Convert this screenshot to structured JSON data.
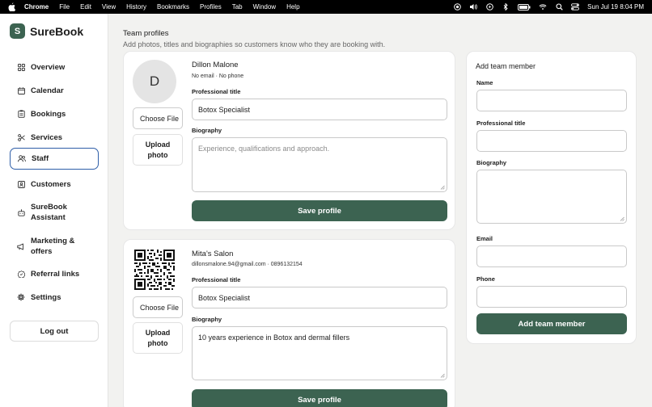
{
  "menubar": {
    "app": "Chrome",
    "items": [
      "File",
      "Edit",
      "View",
      "History",
      "Bookmarks",
      "Profiles",
      "Tab",
      "Window",
      "Help"
    ],
    "clock": "Sun Jul 19  8:04 PM"
  },
  "sidebar": {
    "brand_letter": "S",
    "brand_name": "SureBook",
    "items": [
      {
        "label": "Overview",
        "icon": "grid-icon"
      },
      {
        "label": "Calendar",
        "icon": "calendar-icon"
      },
      {
        "label": "Bookings",
        "icon": "clipboard-icon"
      },
      {
        "label": "Services",
        "icon": "scissors-icon"
      },
      {
        "label": "Staff",
        "icon": "users-icon",
        "active": true
      },
      {
        "label": "Customers",
        "icon": "id-card-icon"
      },
      {
        "label": "SureBook Assistant",
        "icon": "robot-icon"
      },
      {
        "label": "Marketing & offers",
        "icon": "megaphone-icon"
      },
      {
        "label": "Referral links",
        "icon": "badge-icon"
      },
      {
        "label": "Settings",
        "icon": "gear-icon"
      }
    ],
    "logout": "Log out"
  },
  "header": {
    "title": "Team profiles",
    "subtitle": "Add photos, titles and biographies so customers know who they are booking with."
  },
  "members": [
    {
      "avatar_letter": "D",
      "name": "Dillon Malone",
      "contact": "No email · No phone",
      "choose_file": "Choose File",
      "upload": "Upload photo",
      "title_label": "Professional title",
      "title_value": "Botox Specialist",
      "bio_label": "Biography",
      "bio_value": "",
      "bio_placeholder": "Experience, qualifications and approach.",
      "save": "Save profile"
    },
    {
      "name": "Mita's Salon",
      "contact": "dillonsmalone.94@gmail.com · 0896132154",
      "choose_file": "Choose File",
      "upload": "Upload photo",
      "title_label": "Professional title",
      "title_value": "Botox Specialist",
      "bio_label": "Biography",
      "bio_value": "10 years experience in Botox and dermal fillers",
      "save": "Save profile"
    }
  ],
  "add_member": {
    "title": "Add team member",
    "name_label": "Name",
    "title_label": "Professional title",
    "bio_label": "Biography",
    "email_label": "Email",
    "phone_label": "Phone",
    "button": "Add team member"
  },
  "colors": {
    "primary": "#3c6351",
    "active_border": "#2e5ea8",
    "background": "#f2f2f0"
  }
}
